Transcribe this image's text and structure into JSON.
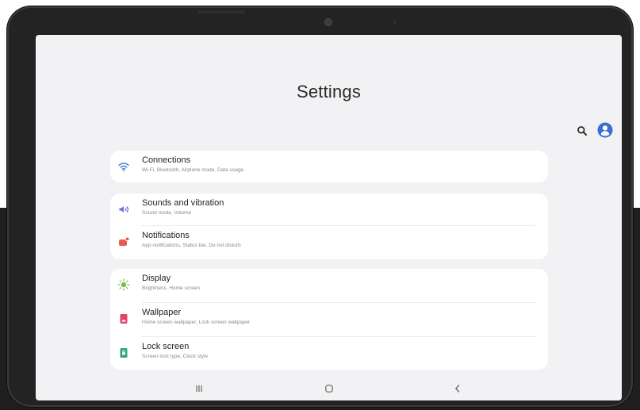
{
  "page": {
    "title": "Settings"
  },
  "header": {
    "search_icon": "search-icon",
    "account_icon": "account-icon"
  },
  "groups": [
    {
      "items": [
        {
          "title": "Connections",
          "subtitle": "Wi-Fi, Bluetooth, Airplane mode, Data usage",
          "icon": "wifi-icon",
          "color": "#4a7fd8"
        }
      ]
    },
    {
      "items": [
        {
          "title": "Sounds and vibration",
          "subtitle": "Sound mode, Volume",
          "icon": "sound-icon",
          "color": "#6b6fd6"
        },
        {
          "title": "Notifications",
          "subtitle": "App notifications, Status bar, Do not disturb",
          "icon": "notifications-icon",
          "color": "#ea5a4e"
        }
      ]
    },
    {
      "items": [
        {
          "title": "Display",
          "subtitle": "Brightness, Home screen",
          "icon": "brightness-icon",
          "color": "#7cc142"
        },
        {
          "title": "Wallpaper",
          "subtitle": "Home screen wallpaper, Lock screen wallpaper",
          "icon": "wallpaper-icon",
          "color": "#e0456a"
        },
        {
          "title": "Lock screen",
          "subtitle": "Screen lock type, Clock style",
          "icon": "lock-screen-icon",
          "color": "#2fa67a"
        }
      ]
    }
  ],
  "nav": {
    "recents_icon": "recents-icon",
    "home_icon": "home-icon",
    "back_icon": "back-icon"
  },
  "colors": {
    "screen_bg": "#f2f2f4",
    "card_bg": "#ffffff",
    "accent": "#3b6fd4"
  }
}
